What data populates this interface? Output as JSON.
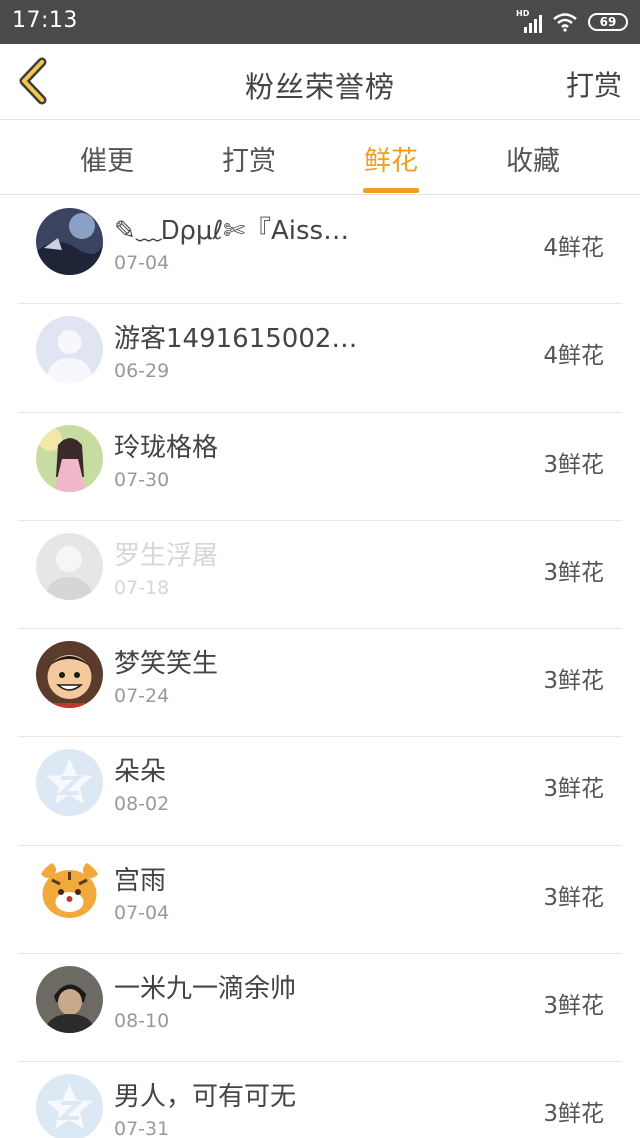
{
  "status_bar": {
    "time": "17:13",
    "network": "HD",
    "battery": "69"
  },
  "header": {
    "title": "粉丝荣誉榜",
    "action": "打赏",
    "back_icon": "chevron-left-icon",
    "accent": "#f0a020"
  },
  "tabs": [
    {
      "label": "催更",
      "active": false
    },
    {
      "label": "打赏",
      "active": false
    },
    {
      "label": "鲜花",
      "active": true
    },
    {
      "label": "收藏",
      "active": false
    }
  ],
  "fans": [
    {
      "name": "✎﹏Ꭰρμℓ✄『Aiss…",
      "date": "07-04",
      "count": "4鲜花",
      "avatar": "scenery-avatar"
    },
    {
      "name": "游客1491615002…",
      "date": "06-29",
      "count": "4鲜花",
      "avatar": "default-person-avatar"
    },
    {
      "name": "玲珑格格",
      "date": "07-30",
      "count": "3鲜花",
      "avatar": "girl-avatar"
    },
    {
      "name": "罗生浮屠",
      "date": "07-18",
      "count": "3鲜花",
      "avatar": "person-photo-avatar",
      "faded": true
    },
    {
      "name": "梦笑笑生",
      "date": "07-24",
      "count": "3鲜花",
      "avatar": "cartoon-face-avatar"
    },
    {
      "name": "朵朵",
      "date": "08-02",
      "count": "3鲜花",
      "avatar": "qzone-star-avatar"
    },
    {
      "name": "宫雨",
      "date": "07-04",
      "count": "3鲜花",
      "avatar": "tiger-avatar"
    },
    {
      "name": "一米九一滴余帅",
      "date": "08-10",
      "count": "3鲜花",
      "avatar": "person-photo-avatar"
    },
    {
      "name": "男人，可有可无",
      "date": "07-31",
      "count": "3鲜花",
      "avatar": "qzone-star-avatar"
    }
  ]
}
